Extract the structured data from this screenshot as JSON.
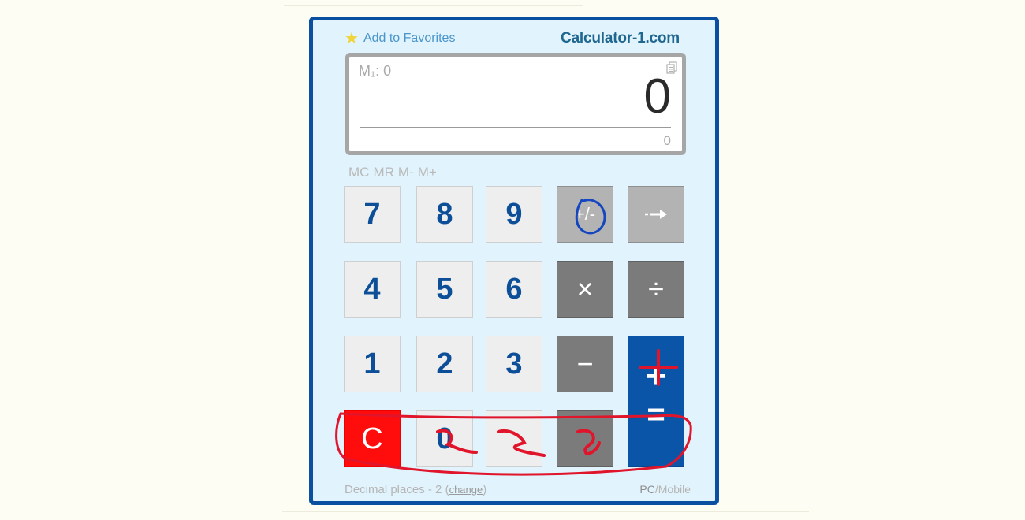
{
  "header": {
    "favorites_label": "Add to Favorites",
    "brand": "Calculator-1.com"
  },
  "display": {
    "memory_label": "M₁: 0",
    "main_value": "0",
    "sub_value": "0"
  },
  "memory_buttons": [
    "MC",
    "MR",
    "M-",
    "M+"
  ],
  "keys": {
    "k7": "7",
    "k8": "8",
    "k9": "9",
    "k4": "4",
    "k5": "5",
    "k6": "6",
    "k1": "1",
    "k2": "2",
    "k3": "3",
    "k0": "0",
    "plusminus": "+/-",
    "multiply": "×",
    "divide": "÷",
    "minus": "−",
    "plus": "+",
    "equals": "=",
    "clear": "C"
  },
  "footer": {
    "decimal_text": "Decimal places - 2",
    "change_label": "change",
    "pc_label": "PC",
    "slash": "/",
    "mobile_label": "Mobile"
  },
  "colors": {
    "frame": "#0a4fa0",
    "panel": "#e1f3fc",
    "digit_text": "#0c4f98",
    "clear_key": "#ff0d0d",
    "equals_key": "#0a55a8",
    "annotation_red": "#e0152b",
    "annotation_blue": "#1446c0"
  }
}
